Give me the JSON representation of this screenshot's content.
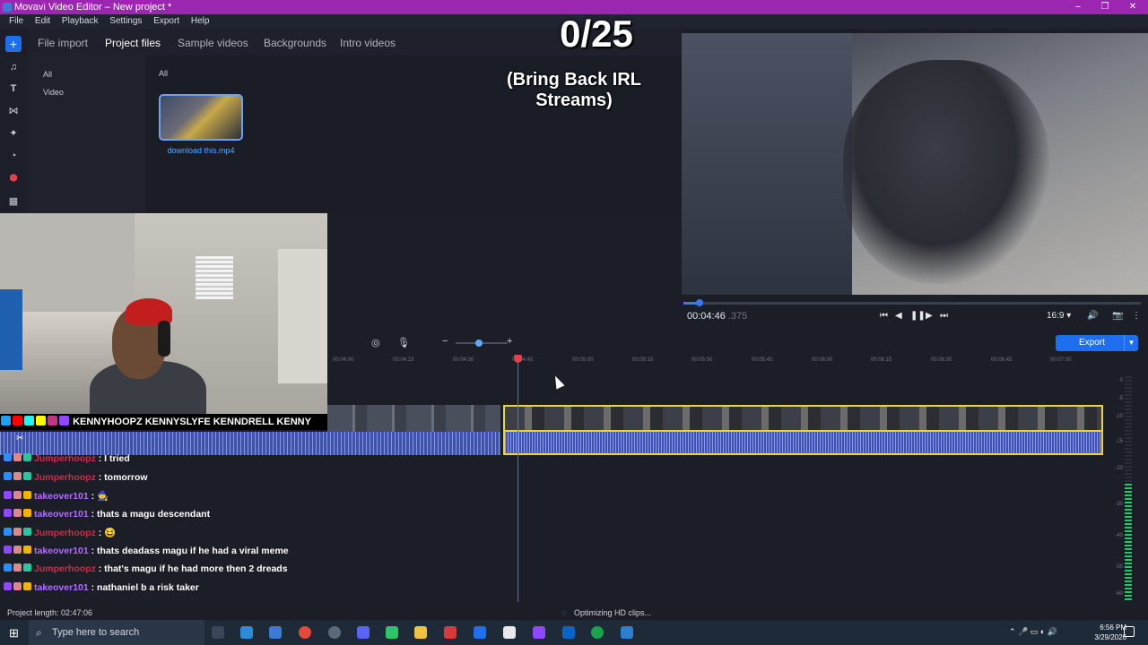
{
  "window": {
    "title": "Movavi Video Editor – New project *"
  },
  "menu": [
    "File",
    "Edit",
    "Playback",
    "Settings",
    "Export",
    "Help"
  ],
  "tabs": [
    "File import",
    "Project files",
    "Sample videos",
    "Backgrounds",
    "Intro videos"
  ],
  "active_tab": "Project files",
  "categories": [
    "All",
    "Video"
  ],
  "main_header": "All",
  "media_file": {
    "name": "download this.mp4"
  },
  "overlay": {
    "score": "0/25",
    "subtitle": "(Bring Back IRL Streams)"
  },
  "player": {
    "timecode": "00:04:46",
    "timecode_frac": ".375",
    "aspect": "16:9 ▾",
    "progress": 0.03
  },
  "export_label": "Export",
  "ruler_ticks": [
    "00:04:00",
    "00:04:15",
    "00:04:30",
    "00:04:45",
    "00:05:00",
    "00:05:15",
    "00:05:30",
    "00:05:45",
    "00:06:00",
    "00:06:15",
    "00:06:30",
    "00:06:45",
    "00:07:00"
  ],
  "social_bar": "KENNYHOOPZ  KENNYSLYFE  KENNDRELL  KENNY",
  "chat": [
    {
      "user": "Jumperhoopz",
      "color": "red",
      "text": ": I tried"
    },
    {
      "user": "Jumperhoopz",
      "color": "red",
      "text": ": tomorrow"
    },
    {
      "user": "takeover101",
      "color": "purple",
      "text": ": 🧙"
    },
    {
      "user": "takeover101",
      "color": "purple",
      "text": ": thats a magu descendant"
    },
    {
      "user": "Jumperhoopz",
      "color": "red",
      "text": ": 😆"
    },
    {
      "user": "takeover101",
      "color": "purple",
      "text": ": thats deadass magu if he had a viral meme"
    },
    {
      "user": "Jumperhoopz",
      "color": "red",
      "text": ": that's magu if he had more then 2 dreads"
    },
    {
      "user": "takeover101",
      "color": "purple",
      "text": ": nathaniel b a risk taker"
    }
  ],
  "meter_labels": [
    "0",
    "-5",
    "-10",
    "-15",
    "-20",
    "-30",
    "-40",
    "-50",
    "-60"
  ],
  "status": {
    "project_length": "Project length: 02:47:06",
    "optimizing": "Optimizing HD clips..."
  },
  "taskbar": {
    "search_placeholder": "Type here to search",
    "time": "6:56 PM",
    "date": "3/29/2026"
  },
  "colors": {
    "accent": "#1e6ff0",
    "titlebar": "#9b27b0",
    "playhead": "#e0414a",
    "clip_selected": "#f0d23a",
    "audio": "#3f51b5"
  }
}
